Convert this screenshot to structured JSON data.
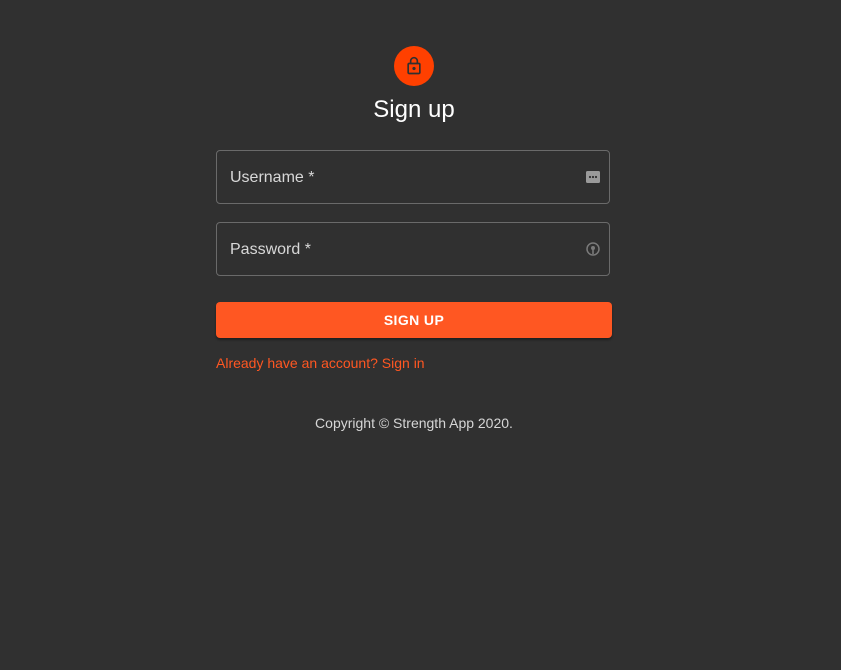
{
  "header": {
    "icon": "lock-icon",
    "title": "Sign up"
  },
  "form": {
    "username": {
      "label": "Username *",
      "value": "",
      "icon": "more-icon"
    },
    "password": {
      "label": "Password *",
      "value": "",
      "icon": "key-icon"
    },
    "submit_label": "SIGN UP",
    "signin_link": "Already have an account? Sign in"
  },
  "footer": {
    "copyright": "Copyright © Strength App 2020."
  },
  "colors": {
    "background": "#303030",
    "accent": "#ff5722",
    "avatar": "#ff4000"
  }
}
